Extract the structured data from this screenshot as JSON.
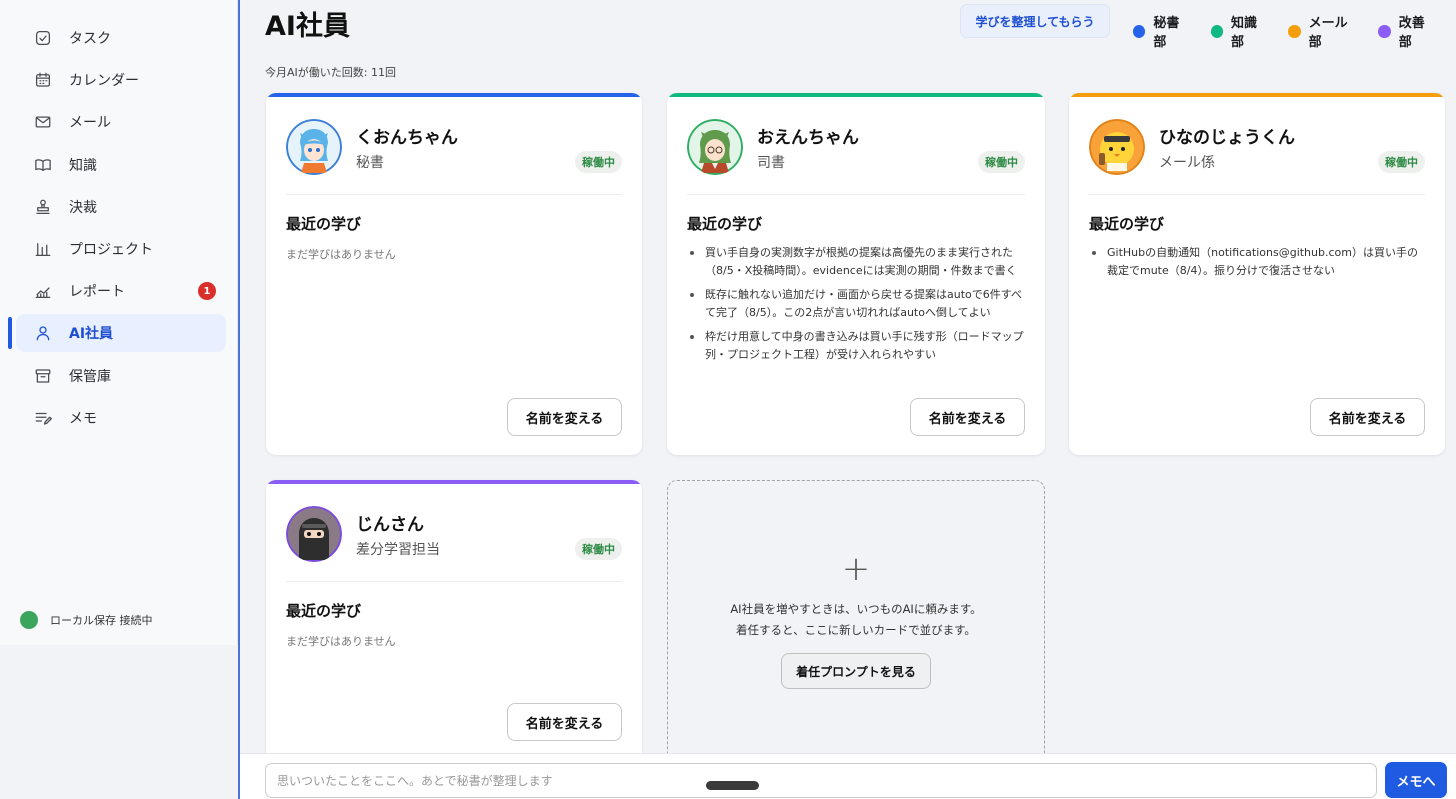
{
  "sidebar": {
    "items": [
      {
        "label": "タスク",
        "icon": "task-check-icon"
      },
      {
        "label": "カレンダー",
        "icon": "calendar-icon"
      },
      {
        "label": "メール",
        "icon": "mail-icon"
      },
      {
        "label": "知識",
        "icon": "book-icon"
      },
      {
        "label": "決裁",
        "icon": "stamp-icon"
      },
      {
        "label": "プロジェクト",
        "icon": "bar-chart-icon"
      },
      {
        "label": "レポート",
        "icon": "line-chart-icon",
        "badge": "1"
      },
      {
        "label": "AI社員",
        "icon": "person-icon",
        "active": true
      },
      {
        "label": "保管庫",
        "icon": "archive-icon"
      },
      {
        "label": "メモ",
        "icon": "memo-icon"
      }
    ],
    "connection": "ローカル保存 接続中"
  },
  "header": {
    "title": "AI社員",
    "organize_button": "学びを整理してもらう",
    "legend": [
      {
        "label": "秘書部",
        "color": "#2563eb"
      },
      {
        "label": "知識部",
        "color": "#10b981"
      },
      {
        "label": "メール部",
        "color": "#f59e0b"
      },
      {
        "label": "改善部",
        "color": "#8b5cf6"
      }
    ],
    "work_count": "今月AIが働いた回数: 11回"
  },
  "cards": [
    {
      "name": "くおんちゃん",
      "role": "秘書",
      "status": "稼働中",
      "color": "#2563eb",
      "learn_heading": "最近の学び",
      "empty": "まだ学びはありません",
      "learnings": [],
      "rename": "名前を変える"
    },
    {
      "name": "おえんちゃん",
      "role": "司書",
      "status": "稼働中",
      "color": "#10b981",
      "learn_heading": "最近の学び",
      "learnings": [
        "買い手自身の実測数字が根拠の提案は高優先のまま実行された（8/5・X投稿時間）。evidenceには実測の期間・件数まで書く",
        "既存に触れない追加だけ・画面から戻せる提案はautoで6件すべて完了（8/5）。この2点が言い切れればautoへ倒してよい",
        "枠だけ用意して中身の書き込みは買い手に残す形（ロードマップ列・プロジェクト工程）が受け入れられやすい"
      ],
      "rename": "名前を変える"
    },
    {
      "name": "ひなのじょうくん",
      "role": "メール係",
      "status": "稼働中",
      "color": "#f59e0b",
      "learn_heading": "最近の学び",
      "learnings": [
        "GitHubの自動通知（notifications@github.com）は買い手の裁定でmute（8/4）。振り分けで復活させない"
      ],
      "rename": "名前を変える"
    },
    {
      "name": "じんさん",
      "role": "差分学習担当",
      "status": "稼働中",
      "color": "#8b5cf6",
      "learn_heading": "最近の学び",
      "empty": "まだ学びはありません",
      "learnings": [],
      "rename": "名前を変える"
    }
  ],
  "add_card": {
    "plus": "+",
    "line1": "AI社員を増やすときは、いつものAIに頼みます。",
    "line2": "着任すると、ここに新しいカードで並びます。",
    "button": "着任プロンプトを見る"
  },
  "bottom": {
    "memo_placeholder": "思いついたことをここへ。あとで秘書が整理します",
    "memo_button": "メモへ"
  }
}
